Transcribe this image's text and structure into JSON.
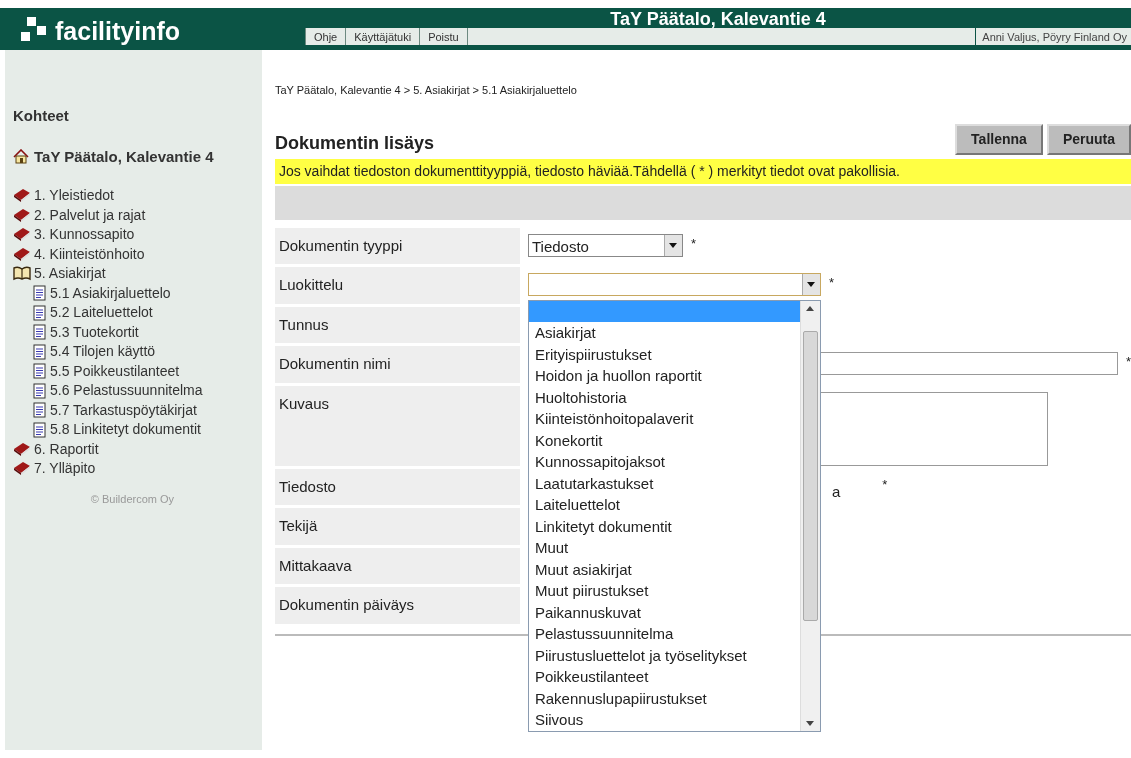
{
  "logo": {
    "text": "facilityinfo"
  },
  "header": {
    "title": "TaY Päätalo, Kalevantie 4",
    "nav": [
      "Ohje",
      "Käyttäjätuki",
      "Poistu"
    ],
    "user": "Anni Valjus, Pöyry Finland Oy"
  },
  "sidebar": {
    "heading": "Kohteet",
    "site": "TaY Päätalo, Kalevantie 4",
    "items": [
      {
        "label": "1. Yleistiedot",
        "kind": "book"
      },
      {
        "label": "2. Palvelut ja rajat",
        "kind": "book"
      },
      {
        "label": "3. Kunnossapito",
        "kind": "book"
      },
      {
        "label": "4. Kiinteistönhoito",
        "kind": "book"
      },
      {
        "label": "5. Asiakirjat",
        "kind": "open-book",
        "children": [
          {
            "label": "5.1 Asiakirjaluettelo",
            "kind": "document"
          },
          {
            "label": "5.2 Laiteluettelot",
            "kind": "document"
          },
          {
            "label": "5.3 Tuotekortit",
            "kind": "document"
          },
          {
            "label": "5.4 Tilojen käyttö",
            "kind": "document"
          },
          {
            "label": "5.5 Poikkeustilanteet",
            "kind": "document"
          },
          {
            "label": "5.6 Pelastussuunnitelma",
            "kind": "document"
          },
          {
            "label": "5.7 Tarkastuspöytäkirjat",
            "kind": "document"
          },
          {
            "label": "5.8 Linkitetyt dokumentit",
            "kind": "document"
          }
        ]
      },
      {
        "label": "6. Raportit",
        "kind": "book"
      },
      {
        "label": "7. Ylläpito",
        "kind": "book"
      }
    ],
    "footer": "© Buildercom Oy"
  },
  "breadcrumb": "TaY Päätalo, Kalevantie 4 > 5. Asiakirjat > 5.1 Asiakirjaluettelo",
  "page_title": "Dokumentin lisäys",
  "buttons": [
    "Tallenna",
    "Peruuta"
  ],
  "notice": "Jos vaihdat tiedoston dokumenttityyppiä, tiedosto häviää.Tähdellä ( * ) merkityt tiedot ovat pakollisia.",
  "form": [
    {
      "label": "Dokumentin tyyppi",
      "kind": "select",
      "value": "Tiedosto",
      "required_mark": "*"
    },
    {
      "label": "Luokittelu",
      "kind": "open-select",
      "required_mark": "*",
      "options": [
        {
          "selected": true
        },
        {
          "label": "Asiakirjat",
          "selected": false
        },
        {
          "label": "Erityispiirustukset",
          "selected": false
        },
        {
          "label": "Hoidon ja huollon raportit",
          "selected": false
        },
        {
          "label": "Huoltohistoria",
          "selected": false
        },
        {
          "label": "Kiinteistönhoitopalaverit",
          "selected": false
        },
        {
          "label": "Konekortit",
          "selected": false
        },
        {
          "label": "Kunnossapitojaksot",
          "selected": false
        },
        {
          "label": "Laatutarkastukset",
          "selected": false
        },
        {
          "label": "Laiteluettelot",
          "selected": false
        },
        {
          "label": "Linkitetyt dokumentit",
          "selected": false
        },
        {
          "label": "Muut",
          "selected": false
        },
        {
          "label": "Muut asiakirjat",
          "selected": false
        },
        {
          "label": "Muut piirustukset",
          "selected": false
        },
        {
          "label": "Paikannuskuvat",
          "selected": false
        },
        {
          "label": "Pelastussuunnitelma",
          "selected": false
        },
        {
          "label": "Piirustusluettelot ja työselitykset",
          "selected": false
        },
        {
          "label": "Poikkeustilanteet",
          "selected": false
        },
        {
          "label": "Rakennuslupapiirustukset",
          "selected": false
        },
        {
          "label": "Siivous",
          "selected": false
        }
      ]
    },
    {
      "label": "Tunnus",
      "kind": "hidden"
    },
    {
      "label": "Dokumentin nimi",
      "kind": "text",
      "required_mark": "*"
    },
    {
      "label": "Kuvaus",
      "kind": "textarea"
    },
    {
      "label": "Tiedosto",
      "kind": "tail",
      "tail": "a",
      "required_mark": "*"
    },
    {
      "label": "Tekijä",
      "kind": "hidden"
    },
    {
      "label": "Mittakaava",
      "kind": "hidden"
    },
    {
      "label": "Dokumentin päiväys",
      "kind": "hidden"
    }
  ]
}
